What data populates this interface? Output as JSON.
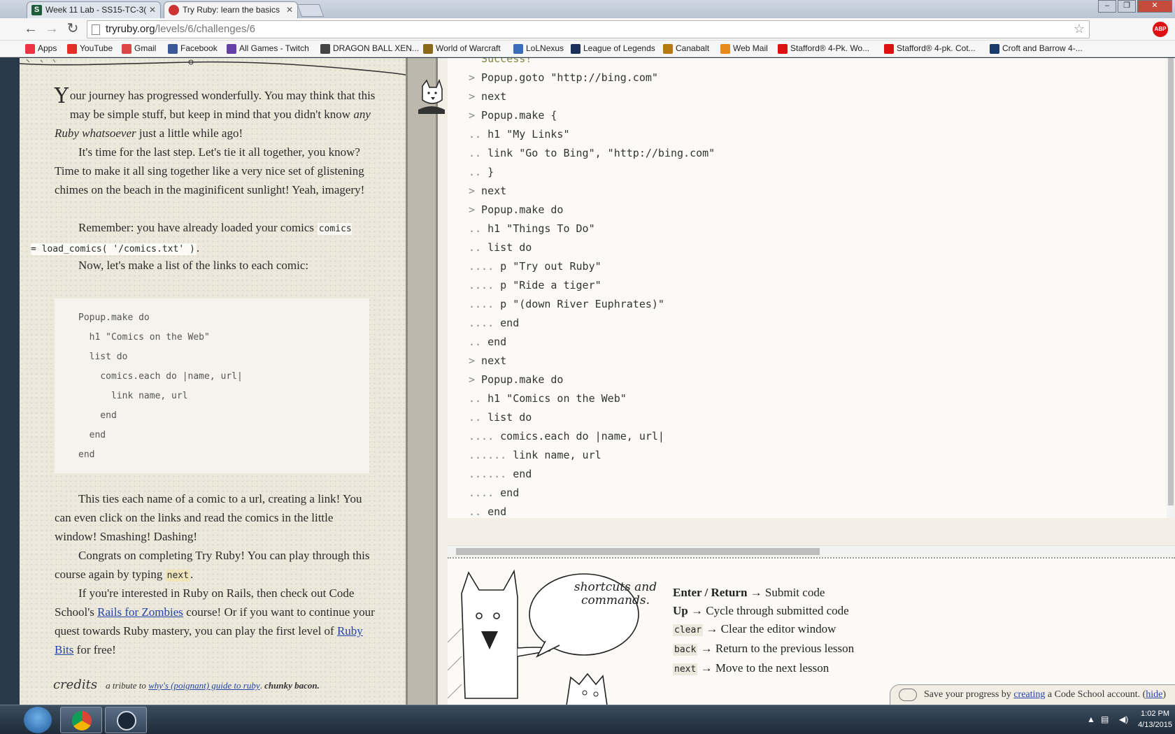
{
  "tabs": [
    {
      "label": "Week 11 Lab - SS15-TC-3(",
      "favicon": "S"
    },
    {
      "label": "Try Ruby: learn the basics",
      "favicon": "TR"
    }
  ],
  "window_controls": {
    "minimize": "–",
    "maximize": "❐",
    "close": "✕"
  },
  "address": {
    "host": "tryruby.org",
    "path": "/levels/6/challenges/6"
  },
  "bookmarks": [
    {
      "label": "Apps",
      "icon": "apps-grid-icon",
      "color": "#e34"
    },
    {
      "label": "YouTube",
      "icon": "youtube-icon",
      "color": "#e52d27"
    },
    {
      "label": "Gmail",
      "icon": "gmail-icon",
      "color": "#d44"
    },
    {
      "label": "Facebook",
      "icon": "facebook-icon",
      "color": "#3b5998"
    },
    {
      "label": "All Games - Twitch",
      "icon": "twitch-icon",
      "color": "#6441a5"
    },
    {
      "label": "DRAGON BALL XEN...",
      "icon": "dragonball-icon",
      "color": "#444"
    },
    {
      "label": "World of Warcraft",
      "icon": "warcraft-icon",
      "color": "#8a6a1a"
    },
    {
      "label": "LoLNexus",
      "icon": "lolnexus-icon",
      "color": "#3b6dbd"
    },
    {
      "label": "League of Legends",
      "icon": "lol-icon",
      "color": "#1a2f5a"
    },
    {
      "label": "Canabalt",
      "icon": "canabalt-icon",
      "color": "#b57a13"
    },
    {
      "label": "Web Mail",
      "icon": "webmail-icon",
      "color": "#e88a1a"
    },
    {
      "label": "Stafford® 4-Pk. Wo...",
      "icon": "jcp-icon",
      "color": "#d11"
    },
    {
      "label": "Stafford® 4-pk. Cot...",
      "icon": "jcp-icon",
      "color": "#d11"
    },
    {
      "label": "Croft and Barrow 4-...",
      "icon": "kohls-icon",
      "color": "#1a3a6b"
    }
  ],
  "lesson": {
    "p1_drop": "Y",
    "p1_a": "our journey has progressed wonderfully. You may think that this may be simple stuff, but keep in mind that you didn't know ",
    "p1_em": "any Ruby whatsoever",
    "p1_b": " just a little while ago!",
    "p2": "It's time for the last step. Let's tie it all together, you know? Time to make it all sing together like a very nice set of glistening chimes on the beach in the maginificent sunlight! Yeah, imagery!",
    "p3": "Remember: you have already loaded your comics with",
    "p3_code": "comics = load_comics( '/comics.txt' )",
    "p3_end": ".",
    "p4": "Now, let's make a list of the links to each comic:",
    "code": [
      "Popup.make do",
      "  h1 \"Comics on the Web\"",
      "  list do",
      "    comics.each do |name, url|",
      "      link name, url",
      "    end",
      "  end",
      "end"
    ],
    "p5": "This ties each name of a comic to a url, creating a link! You can even click on the links and read the comics in the little window! Smashing! Dashing!",
    "p6_a": "Congrats on completing Try Ruby! You can play through this course again by typing ",
    "p6_code": "next",
    "p6_b": ".",
    "p7_a": "If you're interested in Ruby on Rails, then check out Code School's ",
    "p7_link1": "Rails for Zombies",
    "p7_b": " course! Or if you want to continue your quest towards Ruby mastery, you can play the first level of ",
    "p7_link2": "Ruby Bits",
    "p7_c": " for free!",
    "credits_word": "credits",
    "credits_a": "a tribute to ",
    "credits_link": "why's (poignant) guide to ruby",
    "credits_b": ". ",
    "credits_bold": "chunky bacon."
  },
  "console": {
    "lines": [
      {
        "prompt": "",
        "text": "  Success!",
        "kind": "succ"
      },
      {
        "prompt": ">",
        "text": " Popup.goto \"http://bing.com\""
      },
      {
        "prompt": ">",
        "text": " next"
      },
      {
        "prompt": ">",
        "text": " Popup.make {"
      },
      {
        "prompt": "..",
        "text": " h1 \"My Links\""
      },
      {
        "prompt": "..",
        "text": " link \"Go to Bing\", \"http://bing.com\""
      },
      {
        "prompt": "..",
        "text": " }"
      },
      {
        "prompt": ">",
        "text": " next"
      },
      {
        "prompt": ">",
        "text": " Popup.make do"
      },
      {
        "prompt": "..",
        "text": " h1 \"Things To Do\""
      },
      {
        "prompt": "..",
        "text": " list do"
      },
      {
        "prompt": "....",
        "text": " p \"Try out Ruby\""
      },
      {
        "prompt": "....",
        "text": " p \"Ride a tiger\""
      },
      {
        "prompt": "....",
        "text": " p \"(down River Euphrates)\""
      },
      {
        "prompt": "....",
        "text": " end"
      },
      {
        "prompt": "..",
        "text": " end"
      },
      {
        "prompt": ">",
        "text": " next"
      },
      {
        "prompt": ">",
        "text": " Popup.make do"
      },
      {
        "prompt": "..",
        "text": " h1 \"Comics on the Web\""
      },
      {
        "prompt": "..",
        "text": " list do"
      },
      {
        "prompt": "....",
        "text": " comics.each do |name, url|"
      },
      {
        "prompt": "......",
        "text": " link name, url"
      },
      {
        "prompt": "......",
        "text": " end"
      },
      {
        "prompt": "....",
        "text": " end"
      },
      {
        "prompt": "..",
        "text": " end"
      },
      {
        "prompt": ">",
        "text": ""
      }
    ]
  },
  "help": {
    "bubble": "shortcuts and commands.",
    "shortcuts": [
      {
        "key": "Enter / Return",
        "key_style": "bold",
        "desc": "→ Submit code"
      },
      {
        "key": "Up",
        "key_style": "bold",
        "desc": "→ Cycle through submitted code"
      },
      {
        "key": "clear",
        "key_style": "code",
        "desc": "→ Clear the editor window"
      },
      {
        "key": "back",
        "key_style": "code",
        "desc": "→ Return to the previous lesson"
      },
      {
        "key": "next",
        "key_style": "code",
        "desc": "→ Move to the next lesson"
      }
    ],
    "save_a": "Save your progress by ",
    "save_link": "creating",
    "save_b": " a Code School account. (",
    "save_hide": "hide",
    "save_c": ")"
  },
  "taskbar": {
    "time": "1:02 PM",
    "date": "4/13/2015"
  }
}
